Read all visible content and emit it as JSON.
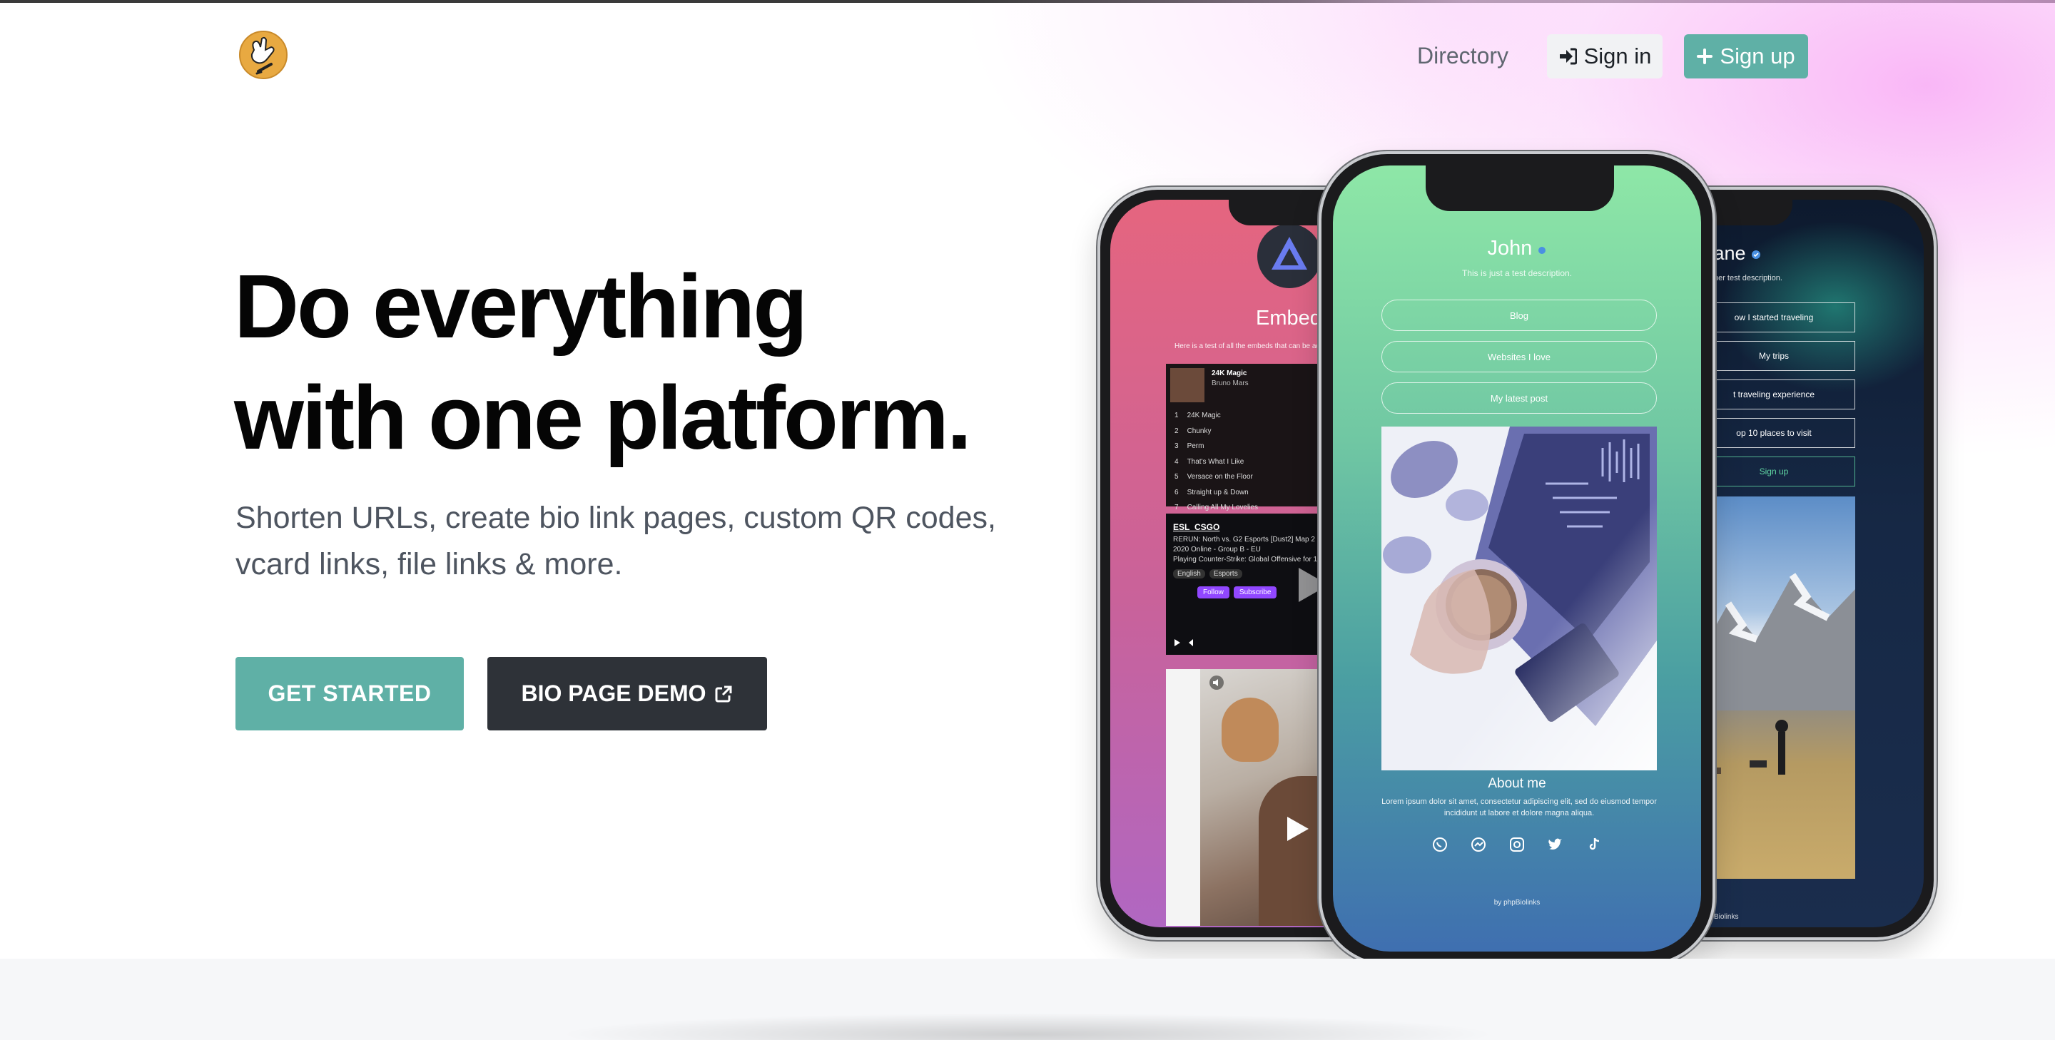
{
  "nav": {
    "directory": "Directory",
    "signin": "Sign in",
    "signup": "Sign up"
  },
  "hero": {
    "title_line1": "Do everything",
    "title_line2": "with one platform.",
    "subtitle": "Shorten URLs, create bio link pages, custom QR codes, vcard links, file links & more.",
    "cta_primary": "GET STARTED",
    "cta_secondary": "BIO PAGE DEMO"
  },
  "phones": {
    "left": {
      "title": "Embeds",
      "description": "Here is a test of all the embeds that can be ad",
      "spotify": {
        "track": "24K Magic",
        "artist": "Bruno Mars",
        "tracks": [
          "24K Magic",
          "Chunky",
          "Perm",
          "That's What I Like",
          "Versace on the Floor",
          "Straight up & Down",
          "Calling All My Lovelies"
        ]
      },
      "twitch": {
        "channel": "ESL_CSGO",
        "line1": "RERUN: North vs. G2 Esports [Dust2] Map 2 -",
        "line2": "2020 Online - Group B - EU",
        "line3": "Playing Counter-Strike: Global Offensive for 1,8",
        "tag1": "English",
        "tag2": "Esports",
        "follow": "Follow",
        "subscribe": "Subscribe"
      }
    },
    "middle": {
      "name": "John",
      "description": "This is just a test description.",
      "links": [
        "Blog",
        "Websites I love",
        "My latest post"
      ],
      "about_title": "About me",
      "about_text": "Lorem ipsum dolor sit amet, consectetur adipiscing elit, sed do eiusmod tempor incididunt ut labore et dolore magna aliqua.",
      "branding": "by phpBiolinks"
    },
    "right": {
      "name": "Jane",
      "description": "s another test description.",
      "links": [
        "ow I started traveling",
        "My trips",
        "t traveling experience",
        "op 10 places to visit",
        "Sign up"
      ],
      "branding": "by phpBiolinks"
    }
  },
  "colors": {
    "accent": "#5fb0a6",
    "dark_button": "#2e3238",
    "headline": "#050505",
    "subtitle": "#4e5560"
  },
  "icons": {
    "signin": "sign-in-icon",
    "signup": "plus-icon",
    "external": "external-link-icon"
  }
}
